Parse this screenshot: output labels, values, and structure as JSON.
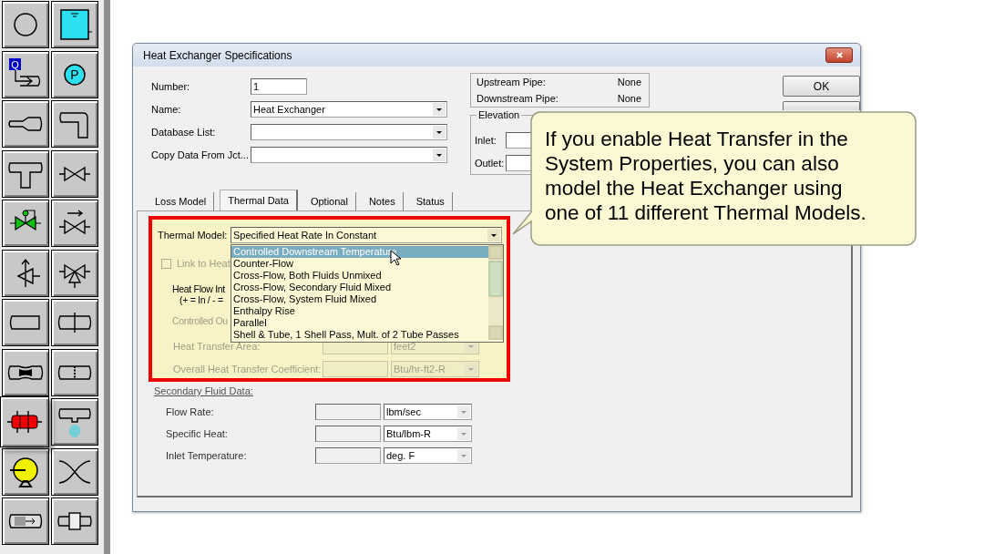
{
  "palette": [
    {
      "kind": "branch",
      "selected": false
    },
    {
      "kind": "reservoir",
      "selected": false
    },
    {
      "kind": "assigned-flow",
      "glyph": "Q",
      "selected": false
    },
    {
      "kind": "assigned-pressure",
      "glyph": "P",
      "selected": false
    },
    {
      "kind": "area-change",
      "selected": false
    },
    {
      "kind": "bend",
      "selected": false
    },
    {
      "kind": "tee",
      "selected": false
    },
    {
      "kind": "valve",
      "selected": false
    },
    {
      "kind": "control-valve",
      "selected": false
    },
    {
      "kind": "check-valve",
      "selected": false
    },
    {
      "kind": "relief-valve",
      "selected": false
    },
    {
      "kind": "three-way-valve",
      "selected": false
    },
    {
      "kind": "dead-end",
      "selected": false
    },
    {
      "kind": "pipe-joint",
      "selected": false
    },
    {
      "kind": "venturi",
      "selected": false
    },
    {
      "kind": "screen",
      "selected": false
    },
    {
      "kind": "heat-exchanger",
      "selected": true
    },
    {
      "kind": "spray",
      "selected": false
    },
    {
      "kind": "pump",
      "selected": false
    },
    {
      "kind": "cross-flow",
      "selected": false
    },
    {
      "kind": "general-component",
      "selected": false
    },
    {
      "kind": "orifice",
      "selected": false
    }
  ],
  "dialog": {
    "title": "Heat Exchanger Specifications",
    "fields": [
      {
        "kind": "text",
        "label": "Number:",
        "value": "1"
      },
      {
        "kind": "combo",
        "label": "Name:",
        "value": "Heat Exchanger"
      },
      {
        "kind": "combo",
        "label": "Database List:"
      },
      {
        "kind": "combo",
        "label": "Copy Data From Jct..."
      }
    ],
    "pipes": [
      {
        "label": "Upstream Pipe:",
        "value": "None"
      },
      {
        "label": "Downstream Pipe:",
        "value": "None"
      }
    ],
    "elevation": {
      "title": "Elevation",
      "fields": [
        {
          "label": "Inlet:"
        },
        {
          "label": "Outlet:"
        }
      ]
    },
    "buttons": [
      {
        "label": "OK"
      }
    ],
    "tabs": [
      {
        "label": "Loss Model",
        "selected": false
      },
      {
        "label": "Thermal Data",
        "selected": true
      },
      {
        "label": "Optional",
        "selected": false
      },
      {
        "label": "Notes",
        "selected": false
      },
      {
        "label": "Status",
        "selected": false
      }
    ],
    "thermal": {
      "label": "Thermal Model:",
      "value": "Specified Heat Rate In Constant",
      "options": [
        {
          "label": "Controlled Downstream Temperature",
          "selected": true
        },
        {
          "label": "Counter-Flow",
          "selected": false
        },
        {
          "label": "Cross-Flow, Both Fluids Unmixed",
          "selected": false
        },
        {
          "label": "Cross-Flow, Secondary Fluid Mixed",
          "selected": false
        },
        {
          "label": "Cross-Flow, System Fluid Mixed",
          "selected": false
        },
        {
          "label": "Enthalpy Rise",
          "selected": false
        },
        {
          "label": "Parallel",
          "selected": false
        },
        {
          "label": "Shell & Tube, 1 Shell Pass, Mult. of 2 Tube Passes",
          "selected": false
        }
      ],
      "link": {
        "label": "Link to Heat",
        "checked": false,
        "disabled": true
      },
      "heat_flow": [
        "Heat Flow Int",
        "(+ = In / - ="
      ],
      "controlled": {
        "label": "Controlled Ou",
        "disabled": true
      },
      "rows": [
        {
          "label": "Heat Transfer Area:",
          "unit": "feet2",
          "disabled": true
        },
        {
          "label": "Overall Heat Transfer Coefficient:",
          "unit": "Btu/hr-ft2-R",
          "disabled": true
        }
      ]
    },
    "secondary": {
      "title": "Secondary Fluid Data:",
      "rows": [
        {
          "label": "Flow Rate:",
          "unit": "lbm/sec",
          "disabled": false
        },
        {
          "label": "Specific Heat:",
          "unit": "Btu/lbm-R",
          "disabled": false
        },
        {
          "label": "Inlet Temperature:",
          "unit": "deg. F",
          "disabled": false
        }
      ]
    }
  },
  "callout": {
    "text": "If you enable Heat Transfer in the System Properties, you can also model the Heat Exchanger using one of 11 different Thermal Models."
  }
}
